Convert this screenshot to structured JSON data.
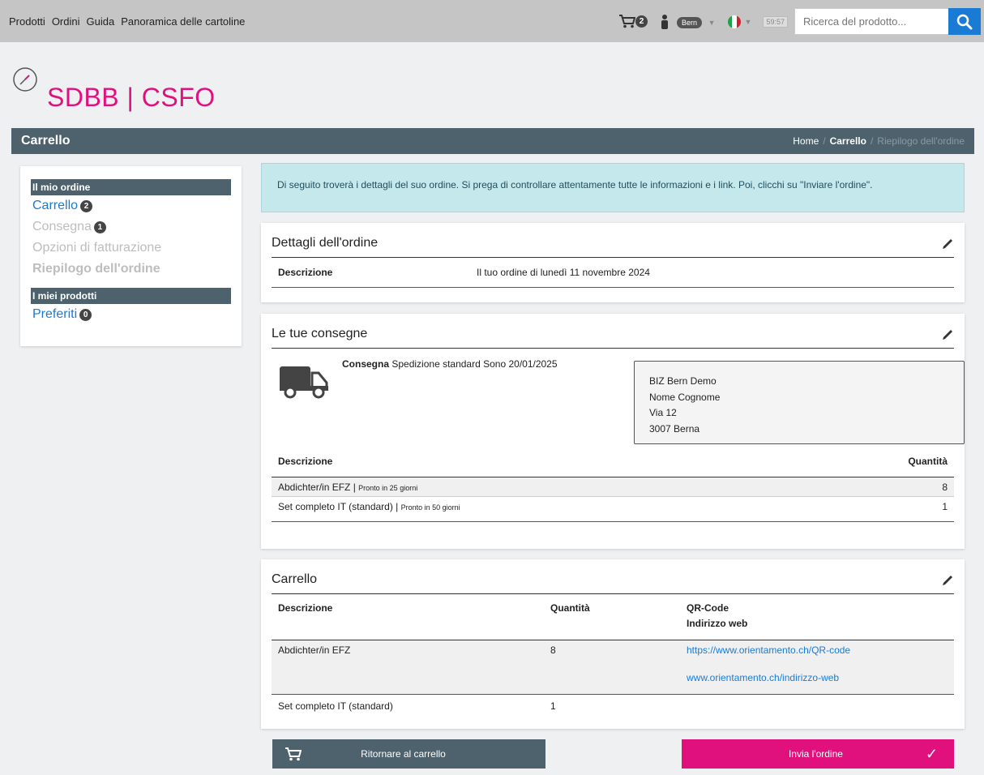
{
  "topnav": {
    "links": [
      "Prodotti",
      "Ordini",
      "Guida",
      "Panoramica delle cartoline"
    ],
    "cart_count": "2",
    "user_badge": "Bern",
    "timer": "59:57",
    "search_placeholder": "Ricerca del prodotto..."
  },
  "brand": {
    "name": "SDBB | CSFO"
  },
  "page": {
    "title": "Carrello",
    "breadcrumbs": [
      "Home",
      "Carrello",
      "Riepilogo dell'ordine"
    ]
  },
  "sidebar": {
    "section1_title": "Il mio ordine",
    "items": [
      {
        "label": "Carrello",
        "badge": "2",
        "state": "active"
      },
      {
        "label": "Consegna",
        "badge": "1",
        "state": "disabled"
      },
      {
        "label": "Opzioni di fatturazione",
        "state": "disabled"
      },
      {
        "label": "Riepilogo dell'ordine",
        "state": "disabled"
      }
    ],
    "section2_title": "I miei prodotti",
    "favorites": {
      "label": "Preferiti",
      "badge": "0"
    }
  },
  "info_message": "Di seguito troverà i dettagli del suo ordine. Si prega di controllare attentamente tutte le informazioni e i link. Poi, clicchi su \"Inviare l'ordine\".",
  "order_details": {
    "title": "Dettagli dell'ordine",
    "label": "Descrizione",
    "value": "Il tuo ordine di lunedì 11 novembre 2024"
  },
  "deliveries": {
    "title": "Le tue consegne",
    "label": "Consegna",
    "text": "Spedizione standard Sono 20/01/2025",
    "address": [
      "BIZ Bern Demo",
      "Nome Cognome",
      "Via 12",
      "3007 Berna"
    ],
    "col_desc": "Descrizione",
    "col_qty": "Quantità",
    "rows": [
      {
        "name": "Abdichter/in EFZ | ",
        "note": "Pronto in 25 giorni",
        "qty": "8"
      },
      {
        "name": "Set completo IT (standard) | ",
        "note": "Pronto in 50 giorni",
        "qty": "1"
      }
    ]
  },
  "cart": {
    "title": "Carrello",
    "col_desc": "Descrizione",
    "col_qty": "Quantità",
    "col_qr": "QR-Code",
    "col_web": "Indirizzo web",
    "rows": [
      {
        "name": "Abdichter/in EFZ",
        "qty": "8",
        "qr": "https://www.orientamento.ch/QR-code",
        "web": "www.orientamento.ch/indirizzo-web"
      },
      {
        "name": "Set completo IT (standard)",
        "qty": "1"
      }
    ]
  },
  "buttons": {
    "back": "Ritornare al carrello",
    "send": "Invia l'ordine"
  },
  "colors": {
    "brand": "#e0117d",
    "primary": "#1a7bd4",
    "header": "#4d626d"
  }
}
